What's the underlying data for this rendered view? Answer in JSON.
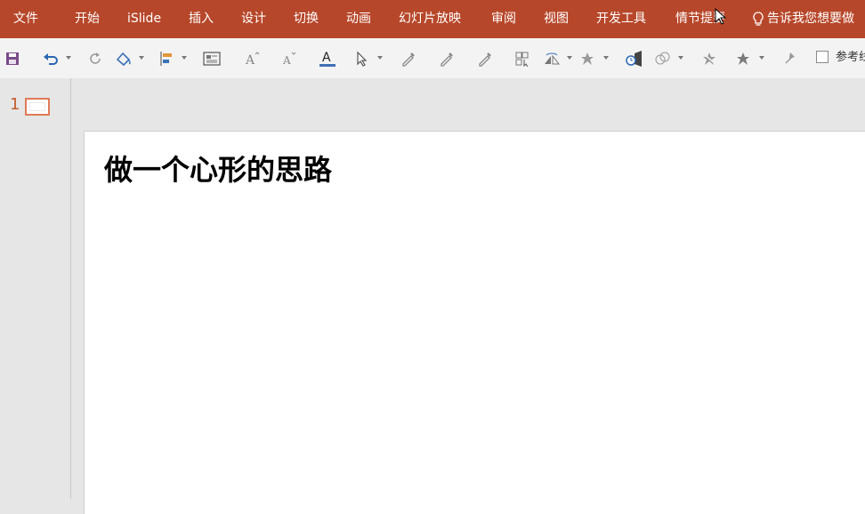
{
  "ribbon": {
    "tabs": [
      {
        "label": "文件"
      },
      {
        "label": "开始"
      },
      {
        "label": "iSlide"
      },
      {
        "label": "插入"
      },
      {
        "label": "设计"
      },
      {
        "label": "切换"
      },
      {
        "label": "动画"
      },
      {
        "label": "幻灯片放映"
      },
      {
        "label": "审阅"
      },
      {
        "label": "视图"
      },
      {
        "label": "开发工具"
      },
      {
        "label": "情节提要"
      }
    ],
    "tell_me": "告诉我您想要做",
    "color": "#b7472a"
  },
  "toolbar": {
    "checkbox_label": "参考线",
    "icons": [
      "save-icon",
      "undo-icon",
      "redo-icon",
      "shape-fill-icon",
      "align-icon",
      "text-box-icon",
      "increase-font-icon",
      "decrease-font-icon",
      "font-color-icon",
      "select-icon",
      "eyedropper-icon",
      "eyedropper-icon",
      "eyedropper-icon",
      "replace-icon",
      "flip-icon",
      "effects-icon",
      "animation-icon",
      "merge-shapes-icon",
      "star-icon",
      "star-filled-icon",
      "pin-icon"
    ]
  },
  "thumbnails": {
    "slide_number": "1"
  },
  "slide": {
    "title": "做一个心形的思路"
  }
}
